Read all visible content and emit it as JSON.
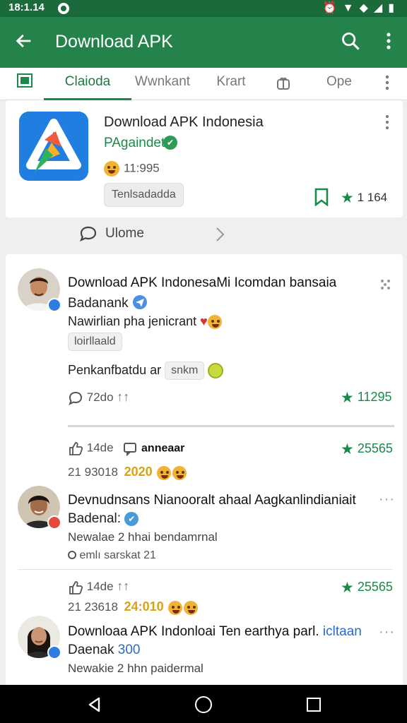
{
  "status_bar": {
    "time": "18:1.14"
  },
  "app_bar": {
    "title": "Download APK"
  },
  "tabs": [
    {
      "label": "Claioda",
      "active": true
    },
    {
      "label": "Wwnkant",
      "active": false
    },
    {
      "label": "Krart",
      "active": false
    },
    {
      "label": "Ope",
      "active": false
    }
  ],
  "app_card": {
    "name": "Download APK Indonesia",
    "developer": "PAgaindet",
    "meta": "11:995",
    "tag": "Tenlsadadda",
    "rating": "1 164"
  },
  "comments_row": {
    "label": "Ulome"
  },
  "post1": {
    "title": "Download APK IndonesaMi Icomdan bansaia",
    "author": "Badanank",
    "line": "Nawirlian pha jenicrant",
    "chip": "loirllaald",
    "line2": "Penkanfbatdu ar",
    "chip2": "snkm",
    "react": "72do",
    "rating": "11295"
  },
  "post2": {
    "likes": "14de",
    "badge": "anneaar",
    "rating": "25565",
    "date": "21 93018",
    "year": "2020",
    "title": "Devnudnsans Nianooralt ahaal Aagkanlindianiait",
    "author": "Badenal:",
    "line": "Newalae 2 hhai bendamrnal",
    "small": "emlı sarskat 21"
  },
  "post3": {
    "likes": "14de",
    "rating": "25565",
    "date": "21 23618",
    "year": "24:010",
    "title": "Downloaa APK Indonloai Ten earthya parl.",
    "title_link": "icltaan",
    "author": "Daenak",
    "author_num": "300",
    "line": "Newakie 2 hhn paidermal"
  },
  "colors": {
    "primary": "#23834a",
    "status_bar": "#1a6a3c",
    "accent": "#1a8a4a"
  }
}
